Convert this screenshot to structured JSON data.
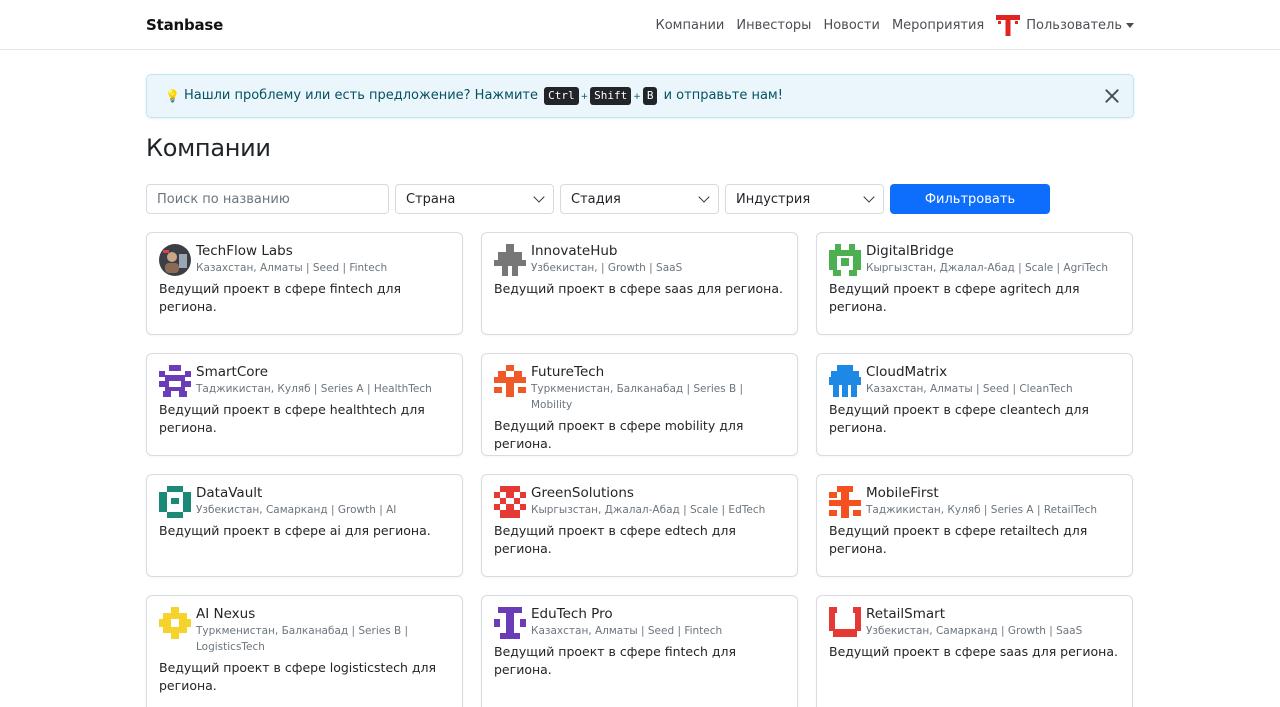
{
  "navbar": {
    "brand": "Stanbase",
    "links": [
      "Компании",
      "Инвесторы",
      "Новости",
      "Мероприятия"
    ],
    "user": "Пользователь"
  },
  "alert": {
    "icon": "lightbulb-icon",
    "text_before": "Нашли проблему или есть предложение? Нажмите",
    "keys": [
      "Ctrl",
      "Shift",
      "B"
    ],
    "separator": "+",
    "text_after": "и отправьте нам!"
  },
  "page": {
    "title": "Компании"
  },
  "filters": {
    "search_placeholder": "Поиск по названию",
    "country": "Страна",
    "stage": "Стадия",
    "industry": "Индустрия",
    "submit": "Фильтровать"
  },
  "companies": [
    {
      "name": "TechFlow Labs",
      "meta": "Казахстан, Алматы | Seed | Fintech",
      "desc": "Ведущий проект в сфере fintech для региона.",
      "logo": "photo-avatar",
      "color": "#3b3f45"
    },
    {
      "name": "InnovateHub",
      "meta": "Узбекистан, | Growth | SaaS",
      "desc": "Ведущий проект в сфере saas для региона.",
      "logo": "cross-identicon",
      "color": "#777777"
    },
    {
      "name": "DigitalBridge",
      "meta": "Кыргызстан, Джалал-Абад | Scale | AgriTech",
      "desc": "Ведущий проект в сфере agritech для региона.",
      "logo": "bridge-identicon",
      "color": "#4caf50"
    },
    {
      "name": "SmartCore",
      "meta": "Таджикистан, Куляб | Series A | HealthTech",
      "desc": "Ведущий проект в сфере healthtech для региона.",
      "logo": "core-identicon",
      "color": "#6a3db8"
    },
    {
      "name": "FutureTech",
      "meta": "Туркменистан, Балканабад | Series B | Mobility",
      "desc": "Ведущий проект в сфере mobility для региона.",
      "logo": "future-identicon",
      "color": "#f05a28"
    },
    {
      "name": "CloudMatrix",
      "meta": "Казахстан, Алматы | Seed | CleanTech",
      "desc": "Ведущий проект в сфере cleantech для региона.",
      "logo": "cloud-identicon",
      "color": "#1e88e5"
    },
    {
      "name": "DataVault",
      "meta": "Узбекистан, Самарканд | Growth | AI",
      "desc": "Ведущий проект в сфере ai для региона.",
      "logo": "vault-identicon",
      "color": "#1a8a76"
    },
    {
      "name": "GreenSolutions",
      "meta": "Кыргызстан, Джалал-Абад | Scale | EdTech",
      "desc": "Ведущий проект в сфере edtech для региона.",
      "logo": "checker-identicon",
      "color": "#e53935"
    },
    {
      "name": "MobileFirst",
      "meta": "Таджикистан, Куляб | Series A | RetailTech",
      "desc": "Ведущий проект в сфере retailtech для региона.",
      "logo": "plus-identicon",
      "color": "#f4511e"
    },
    {
      "name": "AI Nexus",
      "meta": "Туркменистан, Балканабад | Series B | LogisticsTech",
      "desc": "Ведущий проект в сфере logisticstech для региона.",
      "logo": "nexus-identicon",
      "color": "#f6d32b"
    },
    {
      "name": "EduTech Pro",
      "meta": "Казахстан, Алматы | Seed | Fintech",
      "desc": "Ведущий проект в сфере fintech для региона.",
      "logo": "totem-identicon",
      "color": "#6a3db8"
    },
    {
      "name": "RetailSmart",
      "meta": "Узбекистан, Самарканд | Growth | SaaS",
      "desc": "Ведущий проект в сфере saas для региона.",
      "logo": "cup-identicon",
      "color": "#e53935"
    }
  ]
}
